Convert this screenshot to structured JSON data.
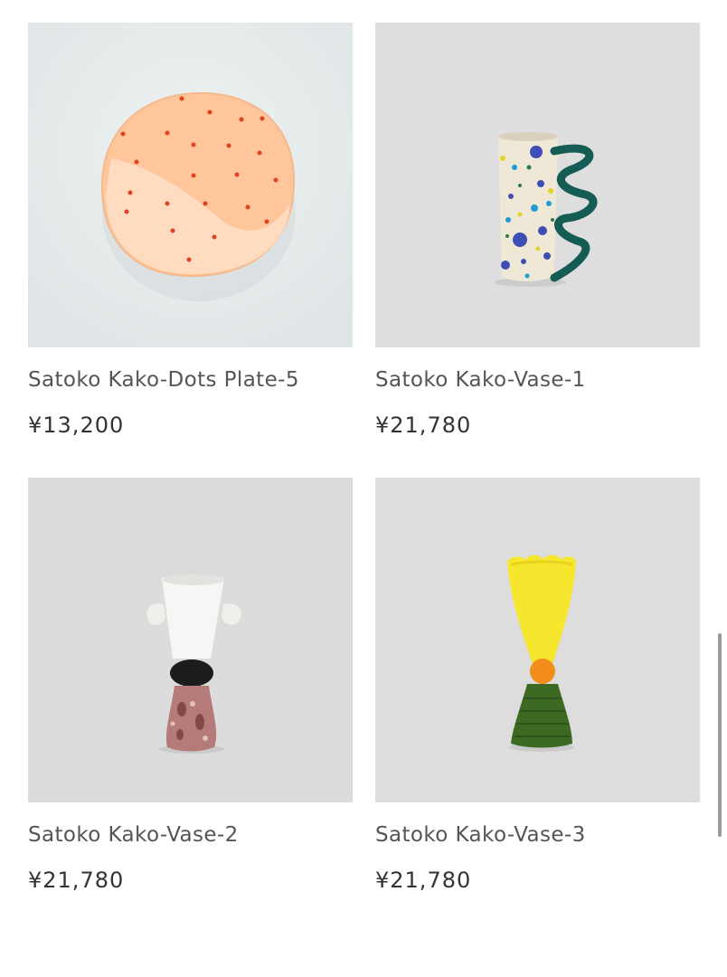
{
  "products": [
    {
      "title": "Satoko Kako-Dots Plate-5",
      "price": "¥13,200"
    },
    {
      "title": "Satoko Kako-Vase-1",
      "price": "¥21,780"
    },
    {
      "title": "Satoko Kako-Vase-2",
      "price": "¥21,780"
    },
    {
      "title": "Satoko Kako-Vase-3",
      "price": "¥21,780"
    }
  ],
  "colors": {
    "plate_bg": "#e4e9ea",
    "vase_bg": "#dddddd",
    "plate": "#ffc79e",
    "dot": "#e0431f",
    "title_text": "#555555",
    "price_text": "#333333"
  }
}
